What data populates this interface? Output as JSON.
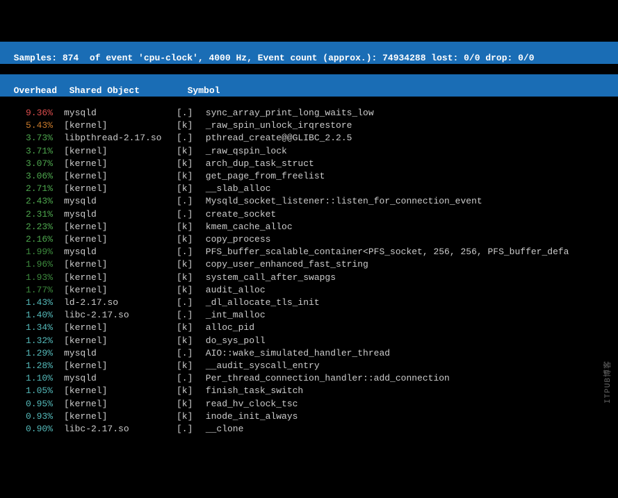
{
  "header": {
    "line1": "Samples: 874  of event 'cpu-clock', 4000 Hz, Event count (approx.): 74934288 lost: 0/0 drop: 0/0",
    "col_overhead": "Overhead",
    "col_shared": "Shared Object",
    "col_symbol": "Symbol"
  },
  "rows": [
    {
      "overhead": "9.36%",
      "ov_class": "c-red",
      "shared": "mysqld",
      "ktype": "[.]",
      "symbol": "sync_array_print_long_waits_low"
    },
    {
      "overhead": "5.43%",
      "ov_class": "c-orange",
      "shared": "[kernel]",
      "ktype": "[k]",
      "symbol": "_raw_spin_unlock_irqrestore"
    },
    {
      "overhead": "3.73%",
      "ov_class": "c-green",
      "shared": "libpthread-2.17.so",
      "ktype": "[.]",
      "symbol": "pthread_create@@GLIBC_2.2.5"
    },
    {
      "overhead": "3.71%",
      "ov_class": "c-green",
      "shared": "[kernel]",
      "ktype": "[k]",
      "symbol": "_raw_qspin_lock"
    },
    {
      "overhead": "3.07%",
      "ov_class": "c-green",
      "shared": "[kernel]",
      "ktype": "[k]",
      "symbol": "arch_dup_task_struct"
    },
    {
      "overhead": "3.06%",
      "ov_class": "c-green",
      "shared": "[kernel]",
      "ktype": "[k]",
      "symbol": "get_page_from_freelist"
    },
    {
      "overhead": "2.71%",
      "ov_class": "c-green",
      "shared": "[kernel]",
      "ktype": "[k]",
      "symbol": "__slab_alloc"
    },
    {
      "overhead": "2.43%",
      "ov_class": "c-green",
      "shared": "mysqld",
      "ktype": "[.]",
      "symbol": "Mysqld_socket_listener::listen_for_connection_event"
    },
    {
      "overhead": "2.31%",
      "ov_class": "c-green",
      "shared": "mysqld",
      "ktype": "[.]",
      "symbol": "create_socket"
    },
    {
      "overhead": "2.23%",
      "ov_class": "c-green",
      "shared": "[kernel]",
      "ktype": "[k]",
      "symbol": "kmem_cache_alloc"
    },
    {
      "overhead": "2.16%",
      "ov_class": "c-green",
      "shared": "[kernel]",
      "ktype": "[k]",
      "symbol": "copy_process"
    },
    {
      "overhead": "1.99%",
      "ov_class": "c-dgreen",
      "shared": "mysqld",
      "ktype": "[.]",
      "symbol": "PFS_buffer_scalable_container<PFS_socket, 256, 256, PFS_buffer_defa"
    },
    {
      "overhead": "1.96%",
      "ov_class": "c-dgreen",
      "shared": "[kernel]",
      "ktype": "[k]",
      "symbol": "copy_user_enhanced_fast_string"
    },
    {
      "overhead": "1.93%",
      "ov_class": "c-dgreen",
      "shared": "[kernel]",
      "ktype": "[k]",
      "symbol": "system_call_after_swapgs"
    },
    {
      "overhead": "1.77%",
      "ov_class": "c-dgreen",
      "shared": "[kernel]",
      "ktype": "[k]",
      "symbol": "audit_alloc"
    },
    {
      "overhead": "1.43%",
      "ov_class": "c-cyan",
      "shared": "ld-2.17.so",
      "ktype": "[.]",
      "symbol": "_dl_allocate_tls_init"
    },
    {
      "overhead": "1.40%",
      "ov_class": "c-cyan",
      "shared": "libc-2.17.so",
      "ktype": "[.]",
      "symbol": "_int_malloc"
    },
    {
      "overhead": "1.34%",
      "ov_class": "c-cyan",
      "shared": "[kernel]",
      "ktype": "[k]",
      "symbol": "alloc_pid"
    },
    {
      "overhead": "1.32%",
      "ov_class": "c-cyan",
      "shared": "[kernel]",
      "ktype": "[k]",
      "symbol": "do_sys_poll"
    },
    {
      "overhead": "1.29%",
      "ov_class": "c-cyan",
      "shared": "mysqld",
      "ktype": "[.]",
      "symbol": "AIO::wake_simulated_handler_thread"
    },
    {
      "overhead": "1.28%",
      "ov_class": "c-cyan",
      "shared": "[kernel]",
      "ktype": "[k]",
      "symbol": "__audit_syscall_entry"
    },
    {
      "overhead": "1.10%",
      "ov_class": "c-cyan",
      "shared": "mysqld",
      "ktype": "[.]",
      "symbol": "Per_thread_connection_handler::add_connection"
    },
    {
      "overhead": "1.05%",
      "ov_class": "c-cyan",
      "shared": "[kernel]",
      "ktype": "[k]",
      "symbol": "finish_task_switch"
    },
    {
      "overhead": "0.95%",
      "ov_class": "c-cyan",
      "shared": "[kernel]",
      "ktype": "[k]",
      "symbol": "read_hv_clock_tsc"
    },
    {
      "overhead": "0.93%",
      "ov_class": "c-cyan",
      "shared": "[kernel]",
      "ktype": "[k]",
      "symbol": "inode_init_always"
    },
    {
      "overhead": "0.90%",
      "ov_class": "c-cyan",
      "shared": "libc-2.17.so",
      "ktype": "[.]",
      "symbol": "__clone"
    }
  ],
  "watermark": "ITPUB博客"
}
